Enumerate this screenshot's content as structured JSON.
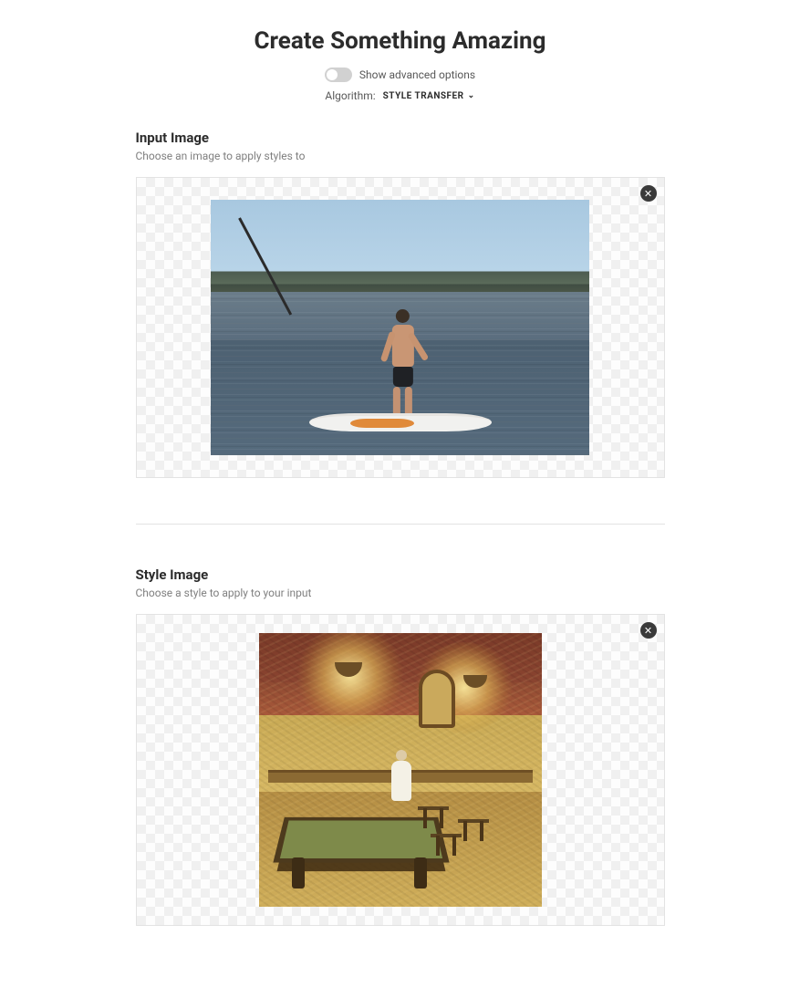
{
  "header": {
    "title": "Create Something Amazing",
    "advanced_toggle_label": "Show advanced options",
    "algorithm_label": "Algorithm:",
    "algorithm_selected": "STYLE TRANSFER"
  },
  "sections": {
    "input": {
      "heading": "Input Image",
      "description": "Choose an image to apply styles to"
    },
    "style": {
      "heading": "Style Image",
      "description": "Choose a style to apply to your input"
    }
  }
}
